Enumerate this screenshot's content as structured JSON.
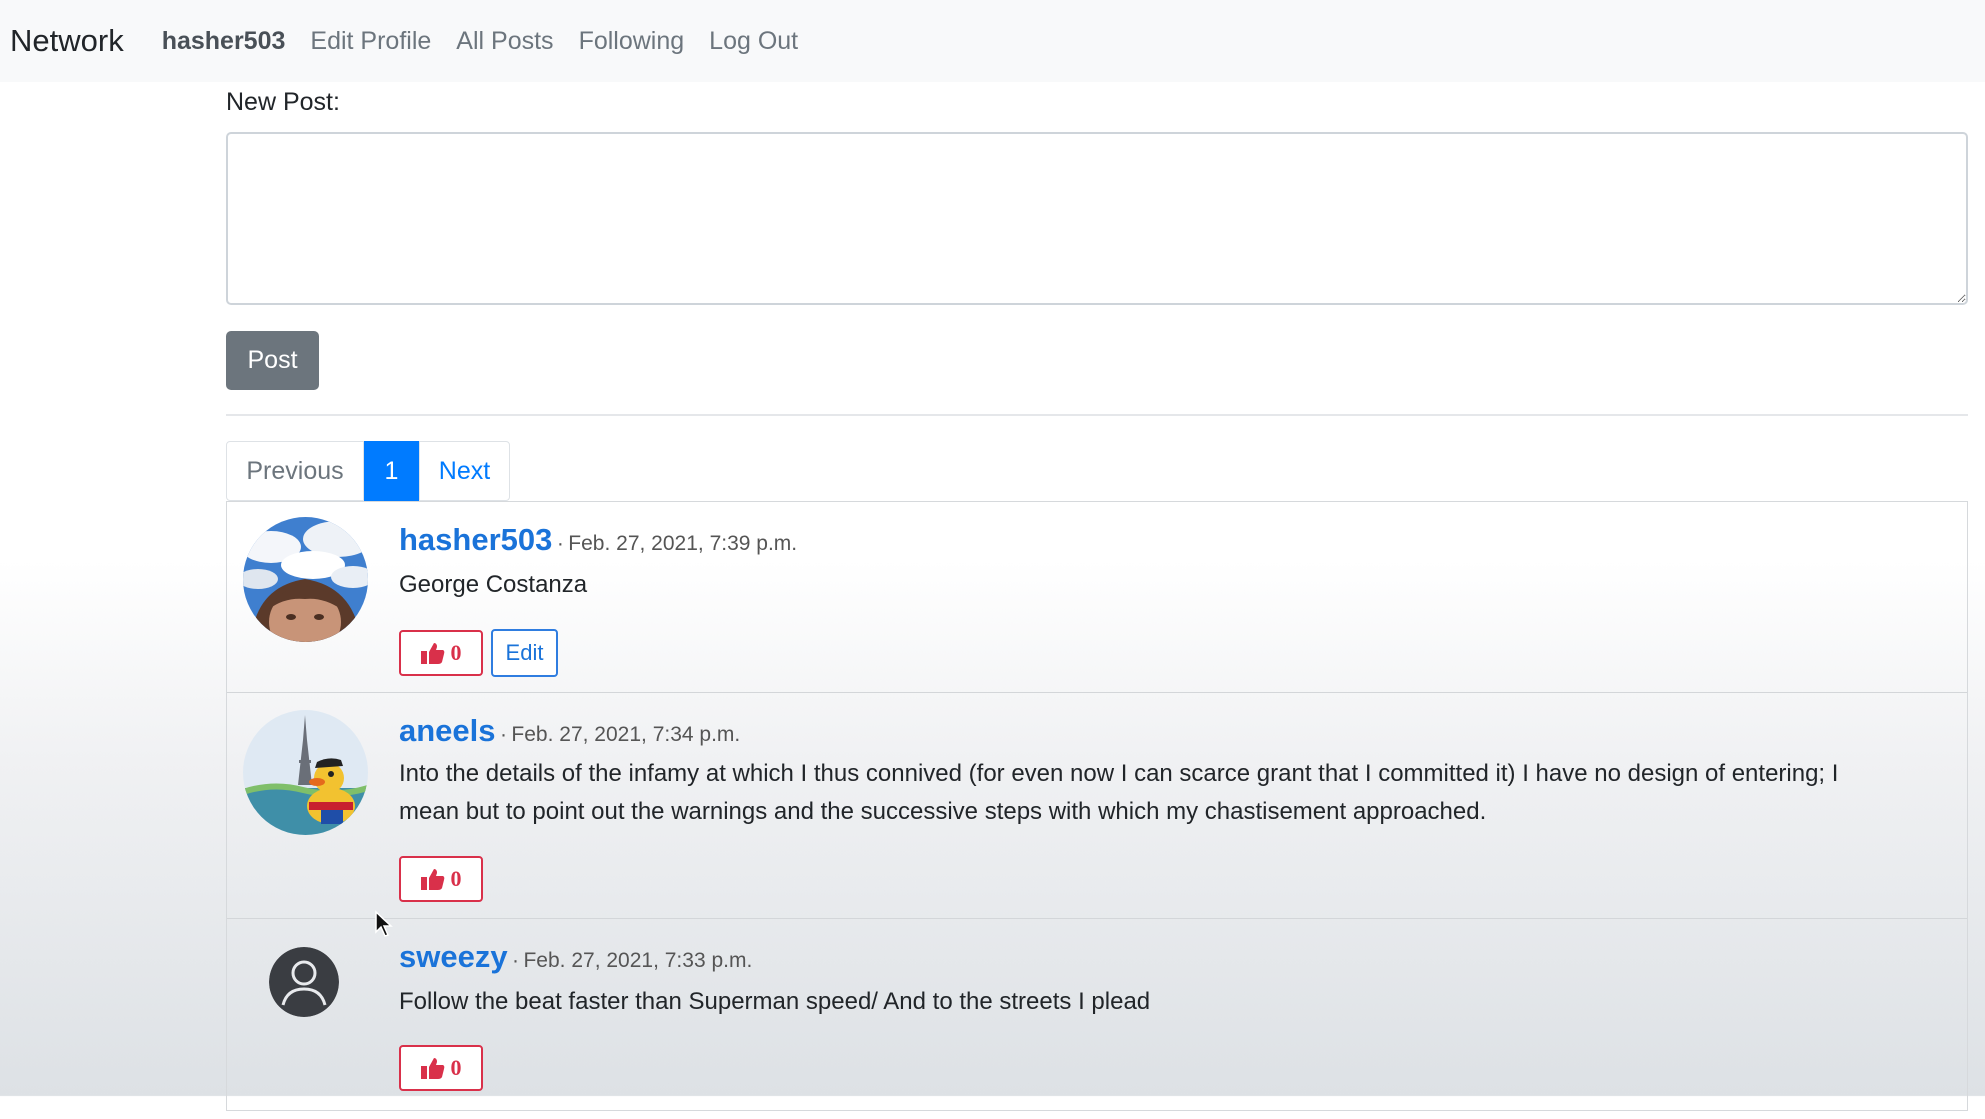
{
  "navbar": {
    "brand": "Network",
    "user": "hasher503",
    "links": [
      "Edit Profile",
      "All Posts",
      "Following",
      "Log Out"
    ]
  },
  "composer": {
    "label": "New Post:",
    "value": "",
    "submit_label": "Post"
  },
  "pagination": {
    "previous": "Previous",
    "current_page": "1",
    "next": "Next"
  },
  "posts": [
    {
      "username": "hasher503",
      "separator": "·",
      "timestamp": "Feb. 27, 2021, 7:39 p.m.",
      "content": "George Costanza",
      "likes": "0",
      "edit_label": "Edit",
      "avatar_icon": "selfie-photo-avatar"
    },
    {
      "username": "aneels",
      "separator": "·",
      "timestamp": "Feb. 27, 2021, 7:34 p.m.",
      "content_line1": "Into the details of the infamy at which I thus connived (for even now I can scarce grant that I committed it) I have no design of entering; I",
      "content_line2": "mean but to point out the warnings and the successive steps with which my chastisement approached.",
      "likes": "0",
      "avatar_icon": "rubber-duck-eiffel-avatar"
    },
    {
      "username": "sweezy",
      "separator": "·",
      "timestamp": "Feb. 27, 2021, 7:33 p.m.",
      "content": "Follow the beat faster than Superman speed/ And to the streets I plead",
      "likes": "0",
      "avatar_icon": "default-user-avatar"
    }
  ],
  "colors": {
    "link_blue": "#1a73d9",
    "like_red": "#d9304a",
    "primary_blue": "#007bff",
    "secondary_gray": "#6c757d"
  }
}
